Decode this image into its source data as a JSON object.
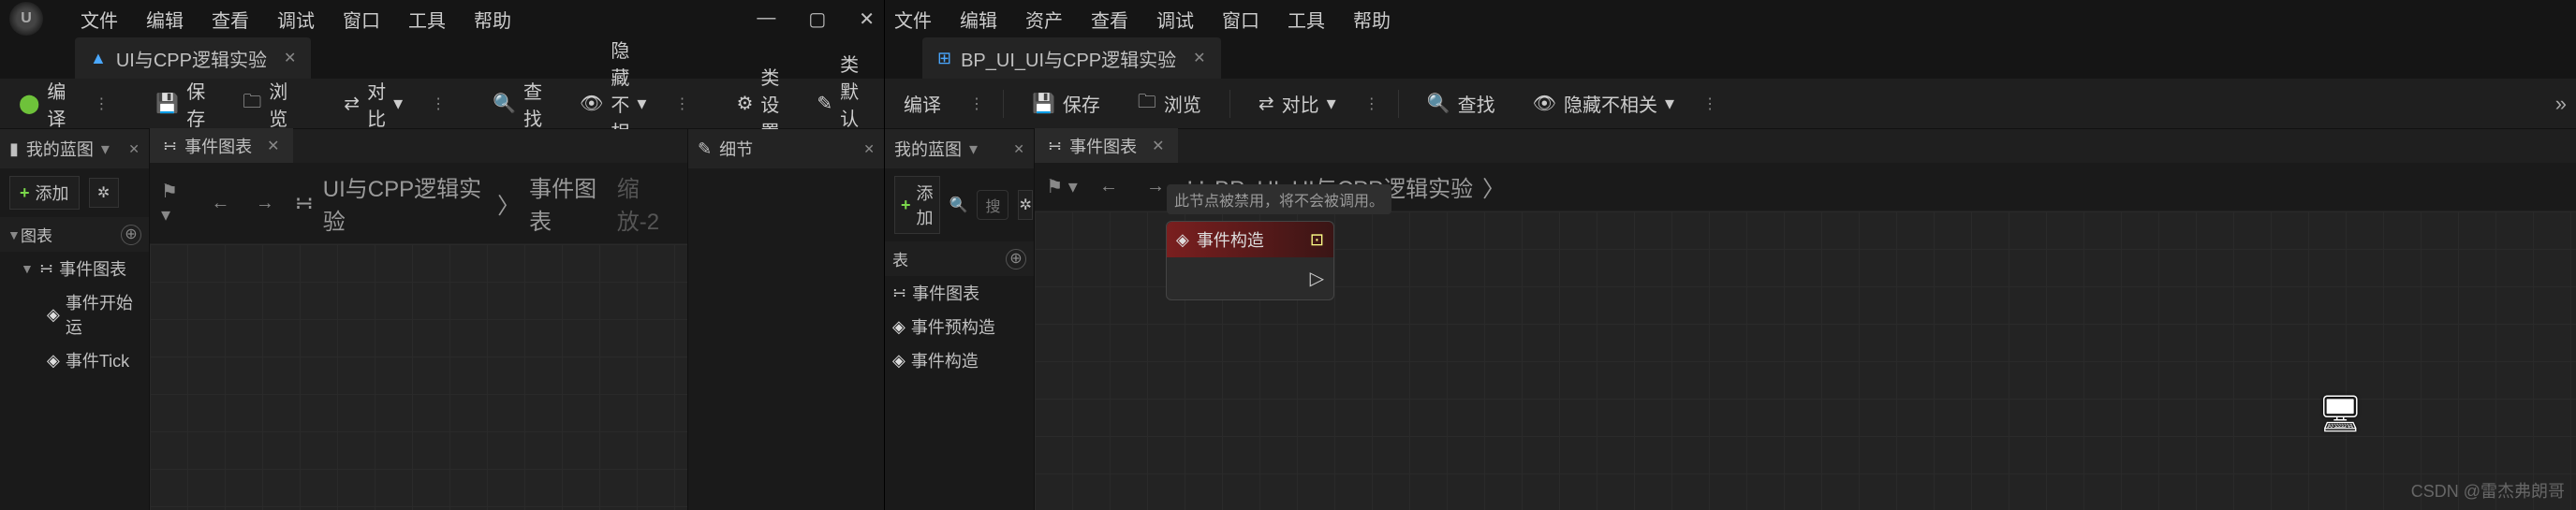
{
  "menus": [
    "文件",
    "编辑",
    "查看",
    "调试",
    "窗口",
    "工具",
    "帮助"
  ],
  "menus2": [
    "文件",
    "编辑",
    "资产",
    "查看",
    "调试",
    "窗口",
    "工具",
    "帮助"
  ],
  "tab1": "UI与CPP逻辑实验",
  "tab2": "BP_UI_UI与CPP逻辑实验",
  "toolbar": {
    "compile": "编译",
    "save": "保存",
    "browse": "浏览",
    "diff": "对比",
    "find": "查找",
    "hide": "隐藏不相关",
    "classSettings": "类设置",
    "classDefaults": "类默认值"
  },
  "panels": {
    "myBlueprint": "我的蓝图",
    "eventGraph": "事件图表",
    "details": "细节",
    "add": "添加",
    "search": "搜",
    "charts": "图表",
    "eventBegin": "事件开始运",
    "eventTick": "事件Tick",
    "eventPre": "事件预构造",
    "eventCon": "事件构造",
    "tableHdr": "表"
  },
  "breadcrumb": {
    "root1": "UI与CPP逻辑实验",
    "leaf1": "事件图表",
    "zoom": "缩放-2",
    "root2": "BP_UI_UI与CPP逻辑实验"
  },
  "node": {
    "title": "事件构造",
    "tooltip": "此节点被禁用，将不会被调用。"
  },
  "watermark": "CSDN @雷杰弗朗哥"
}
